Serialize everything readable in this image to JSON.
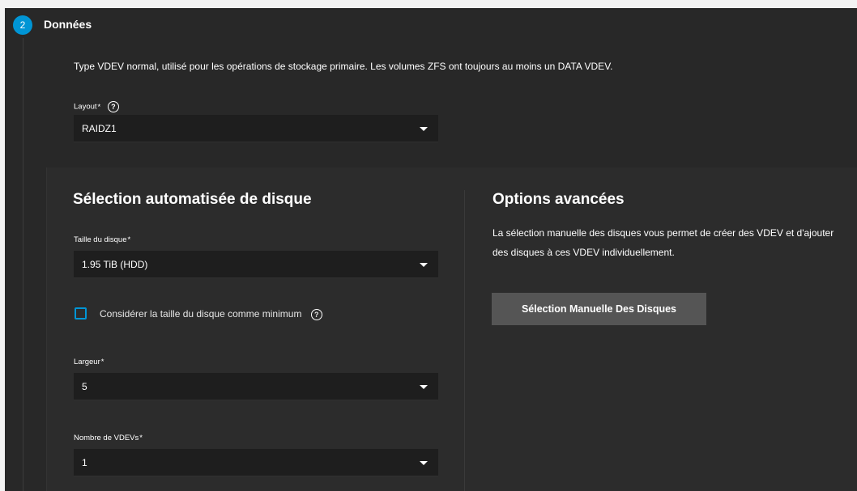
{
  "step": {
    "number": "2",
    "title": "Données",
    "description": "Type VDEV normal, utilisé pour les opérations de stockage primaire. Les volumes ZFS ont toujours au moins un DATA VDEV."
  },
  "layout_field": {
    "label": "Layout",
    "required": "*",
    "help_icon": "help-circle-icon",
    "value": "RAIDZ1"
  },
  "auto_section": {
    "title": "Sélection automatisée de disque",
    "disk_size": {
      "label": "Taille du disque",
      "required": "*",
      "value": "1.95 TiB (HDD)"
    },
    "min_checkbox": {
      "label": "Considérer la taille du disque comme minimum",
      "checked": false,
      "help_icon": "help-circle-icon"
    },
    "width": {
      "label": "Largeur",
      "required": "*",
      "value": "5"
    },
    "vdev_count": {
      "label": "Nombre de VDEVs",
      "required": "*",
      "value": "1"
    }
  },
  "advanced_section": {
    "title": "Options avancées",
    "text": "La sélection manuelle des disques vous permet de créer des VDEV et d'ajouter des disques à ces VDEV individuellement.",
    "button_label": "Sélection Manuelle Des Disques"
  },
  "colors": {
    "accent": "#0095d5",
    "panel": "#282828",
    "card": "#2c2c2c",
    "input": "#1e1e1e",
    "button": "#555555"
  }
}
